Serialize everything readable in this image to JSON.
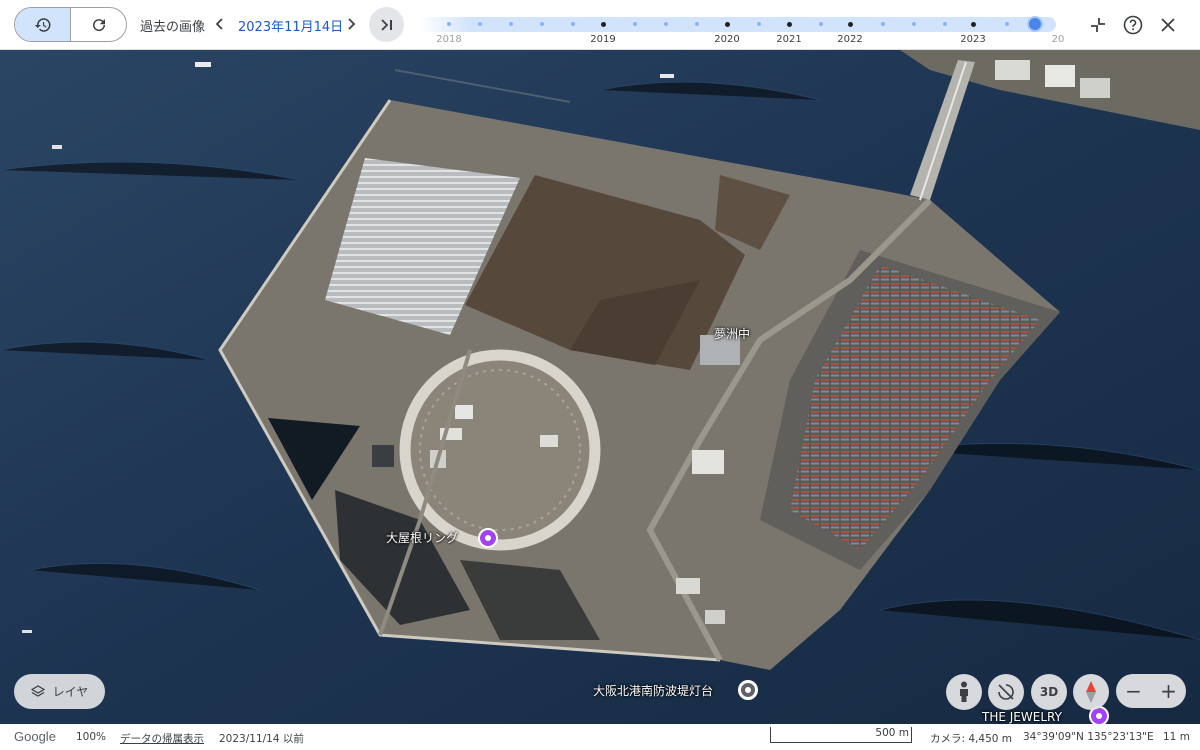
{
  "toolbar": {
    "history_label": "過去の画像",
    "date": "2023年11月14日",
    "history_button_icon": "history-icon",
    "refresh_button_icon": "refresh-icon",
    "prev_icon": "chevron-left-icon",
    "next_icon": "chevron-right-icon",
    "latest_icon": "skip-to-latest-icon"
  },
  "timeline": {
    "years": [
      "2018",
      "2019",
      "2020",
      "2021",
      "2022",
      "2023",
      "20"
    ],
    "selected_date": "2023-11-14"
  },
  "top_right": {
    "collapse_icon": "collapse-icon",
    "help_icon": "help-icon",
    "close_icon": "close-icon"
  },
  "map": {
    "labels": {
      "yumeshima": "夢洲中",
      "ring": "大屋根リング",
      "lighthouse": "大阪北港南防波堤灯台",
      "jewelry": "THE JEWELRY"
    }
  },
  "controls": {
    "layers_label": "レイヤ",
    "three_d_label": "3D",
    "zoom_out": "−",
    "zoom_in": "+",
    "pegman_icon": "pegman-icon",
    "rotate_icon": "rotate-off-icon",
    "compass_icon": "compass-icon"
  },
  "status": {
    "logo": "Google",
    "zoom": "100%",
    "data_link": "データの帰属表示",
    "capture_date": "2023/11/14 以前",
    "scale": "500 m",
    "camera": "カメラ: 4,450 m",
    "coords": "34°39'09\"N 135°23'13\"E",
    "elevation": "11 m"
  },
  "colors": {
    "accent": "#1a57c8",
    "timeline_track": "#d2e3fc",
    "timeline_knob": "#4a86e8",
    "poi": "#a142f4",
    "sea": "#1b3048"
  }
}
